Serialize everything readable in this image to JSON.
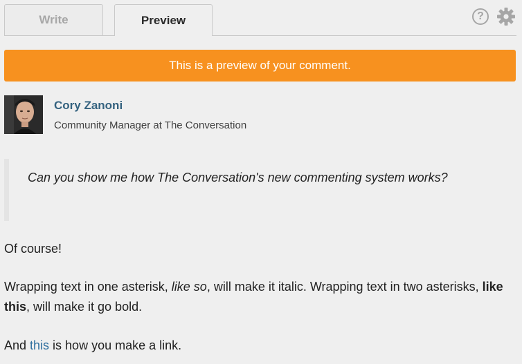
{
  "tabs": {
    "write_label": "Write",
    "preview_label": "Preview",
    "help_glyph": "?"
  },
  "banner": {
    "text": "This is a preview of your comment."
  },
  "author": {
    "name": "Cory Zanoni",
    "title": "Community Manager at The Conversation"
  },
  "quote": {
    "text": "Can you show me how The Conversation's new commenting system works?"
  },
  "body": {
    "p1": "Of course!",
    "p2_a": "Wrapping text in one asterisk, ",
    "p2_italic": "like so",
    "p2_b": ", will make it italic. Wrapping text in two asterisks, ",
    "p2_bold": "like this",
    "p2_c": ", will make it go bold.",
    "p3_a": "And ",
    "p3_link": "this",
    "p3_b": " is how you make a link."
  },
  "colors": {
    "accent_orange": "#f7911f",
    "link_blue": "#2f6f9f",
    "author_blue": "#34627f"
  },
  "icons": [
    "help-icon",
    "gear-icon"
  ]
}
